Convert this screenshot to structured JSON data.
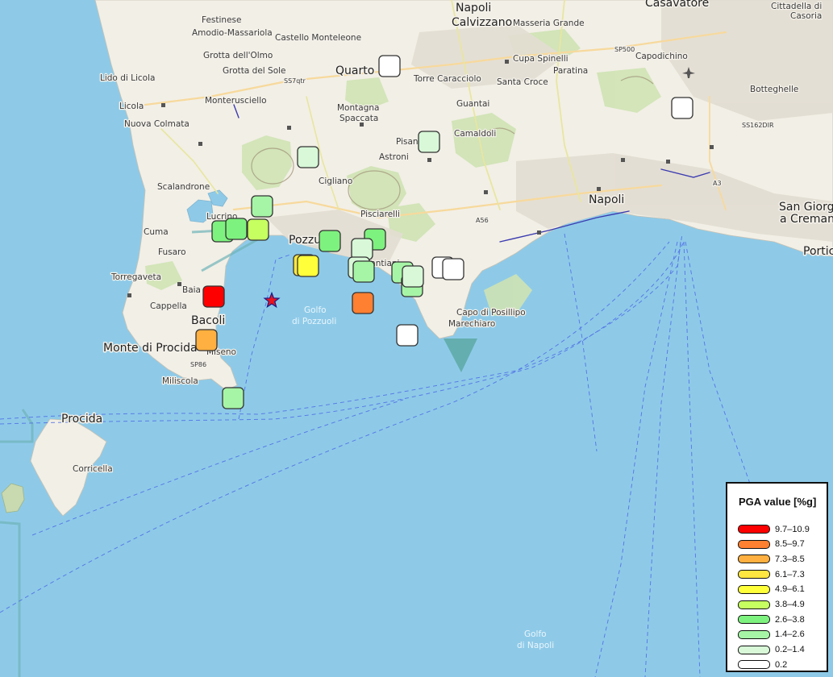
{
  "legend": {
    "title": "PGA value [%g]",
    "items": [
      {
        "label": "9.7–10.9",
        "color": "#ff0000"
      },
      {
        "label": "8.5–9.7",
        "color": "#ff8030"
      },
      {
        "label": "7.3–8.5",
        "color": "#ffb040"
      },
      {
        "label": "6.1–7.3",
        "color": "#ffe640"
      },
      {
        "label": "4.9–6.1",
        "color": "#ffff3a"
      },
      {
        "label": "3.8–4.9",
        "color": "#c6ff60"
      },
      {
        "label": "2.6–3.8",
        "color": "#7ef27e"
      },
      {
        "label": "1.4–2.6",
        "color": "#a6f5a6"
      },
      {
        "label": "0.2–1.4",
        "color": "#d8f8d8"
      },
      {
        "label": "0.2",
        "color": "#ffffff"
      }
    ]
  },
  "stations": [
    {
      "pga_class": "0.2"
    },
    {
      "pga_class": "0.2"
    },
    {
      "pga_class": "0.2–1.4"
    },
    {
      "pga_class": "0.2–1.4"
    },
    {
      "pga_class": "1.4–2.6"
    },
    {
      "pga_class": "2.6–3.8"
    },
    {
      "pga_class": "2.6–3.8"
    },
    {
      "pga_class": "3.8–4.9"
    },
    {
      "pga_class": "2.6–3.8"
    },
    {
      "pga_class": "2.6–3.8"
    },
    {
      "pga_class": "6.1–7.3"
    },
    {
      "pga_class": "4.9–6.1"
    },
    {
      "pga_class": "0.2–1.4"
    },
    {
      "pga_class": "0.2–1.4"
    },
    {
      "pga_class": "1.4–2.6"
    },
    {
      "pga_class": "1.4–2.6"
    },
    {
      "pga_class": "1.4–2.6"
    },
    {
      "pga_class": "0.2–1.4"
    },
    {
      "pga_class": "0.2"
    },
    {
      "pga_class": "0.2"
    },
    {
      "pga_class": "9.7–10.9"
    },
    {
      "pga_class": "8.5–9.7"
    },
    {
      "pga_class": "7.3–8.5"
    },
    {
      "pga_class": "0.2"
    },
    {
      "pga_class": "1.4–2.6"
    }
  ],
  "epicenter": {
    "symbol": "star-icon",
    "color": "#e8141e"
  },
  "places": {
    "napoli": "Napoli",
    "pozzuoli": "Pozzuoli",
    "quarto": "Quarto",
    "napoli_n": "Napoli",
    "calvizzano": "Calvizzano",
    "casavatore": "Casavatore",
    "cittadella": "Cittadella di",
    "casoria": "Casoria",
    "festinese": "Festinese",
    "amodio": "Amodio-Massariola",
    "castello": "Castello Monteleone",
    "masseria": "Masseria Grande",
    "grotta_olmo": "Grotta dell'Olmo",
    "grotta_sole": "Grotta del Sole",
    "cupa": "Cupa Spinelli",
    "capodichino": "Capodichino",
    "lido": "Lido di Licola",
    "licola": "Licola",
    "nuova_colmata": "Nuova Colmata",
    "monterusciello": "Monterusciello",
    "montagna": "Montagna",
    "spaccata": "Spaccata",
    "torre": "Torre Caracciolo",
    "santa_croce": "Santa Croce",
    "paratina": "Paratina",
    "botteghelle": "Botteghelle",
    "guantai": "Guantai",
    "camaldoli": "Camaldoli",
    "pisani": "Pisani",
    "astroni": "Astroni",
    "scalandrone": "Scalandrone",
    "cigliano": "Cigliano",
    "pisciarelli": "Pisciarelli",
    "lucrino": "Lucrino",
    "cuma": "Cuma",
    "fusaro": "Fusaro",
    "torregaveta": "Torregaveta",
    "baia": "Baia",
    "cappella": "Cappella",
    "bacoli": "Bacoli",
    "monte_procida": "Monte di Procida",
    "miseno": "Miseno",
    "miliscola": "Miliscola",
    "procida": "Procida",
    "corricella": "Corricella",
    "golfo_pozzuoli_1": "Golfo",
    "golfo_pozzuoli_2": "di Pozzuoli",
    "capo_posillipo": "Capo di Posillipo",
    "marechiaro": "Marechiaro",
    "golfo_napoli_1": "Golfo",
    "golfo_napoli_2": "di Napoli",
    "san_giorgio_1": "San Giorgio",
    "san_giorgio_2": "a Cremano",
    "portici": "Portic",
    "cantiani": "Cantiani",
    "road_1": "SP86",
    "road_2": "A56",
    "road_3": "SS7qtr",
    "road_4": "SP500",
    "road_5": "SS162DIR",
    "road_6": "A3"
  }
}
